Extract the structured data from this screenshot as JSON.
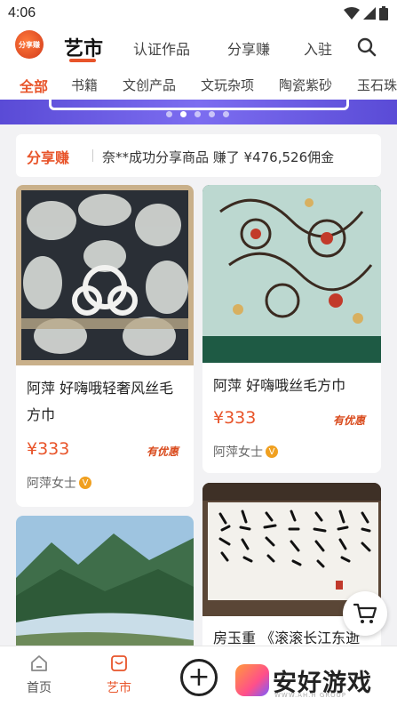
{
  "status": {
    "time": "4:06"
  },
  "header": {
    "logo_text": "分享赚",
    "tabs": [
      {
        "label": "艺市",
        "active": true
      },
      {
        "label": "认证作品"
      },
      {
        "label": "分享赚"
      },
      {
        "label": "入驻"
      }
    ],
    "search_icon": "search-icon"
  },
  "categories": [
    "全部",
    "书籍",
    "文创产品",
    "文玩杂项",
    "陶瓷紫砂",
    "玉石珠宝"
  ],
  "banner": {
    "dot_count": 5,
    "active_index": 1
  },
  "earn": {
    "tag": "分享赚",
    "message": "奈**成功分享商品 赚了 ¥476,526佣金"
  },
  "products": [
    {
      "title_line1": "阿萍 好嗨哦轻奢风丝毛",
      "title_line2": "方巾",
      "price": "¥333",
      "badge": "有优惠",
      "seller": "阿萍女士",
      "verified": "V"
    },
    {
      "title_line1": "阿萍 好嗨哦丝毛方巾",
      "price": "¥333",
      "badge": "有优惠",
      "seller": "阿萍女士",
      "verified": "V"
    },
    {
      "title_line1": ""
    },
    {
      "title_line1": "房玉重 《滚滚长江东逝"
    }
  ],
  "tabbar": {
    "home": "首页",
    "market": "艺市"
  },
  "watermark": {
    "text": "安好游戏",
    "sub": "WWW.AH.H GROUP"
  },
  "colors": {
    "accent": "#e8542a",
    "banner": "#6a5ae0"
  }
}
